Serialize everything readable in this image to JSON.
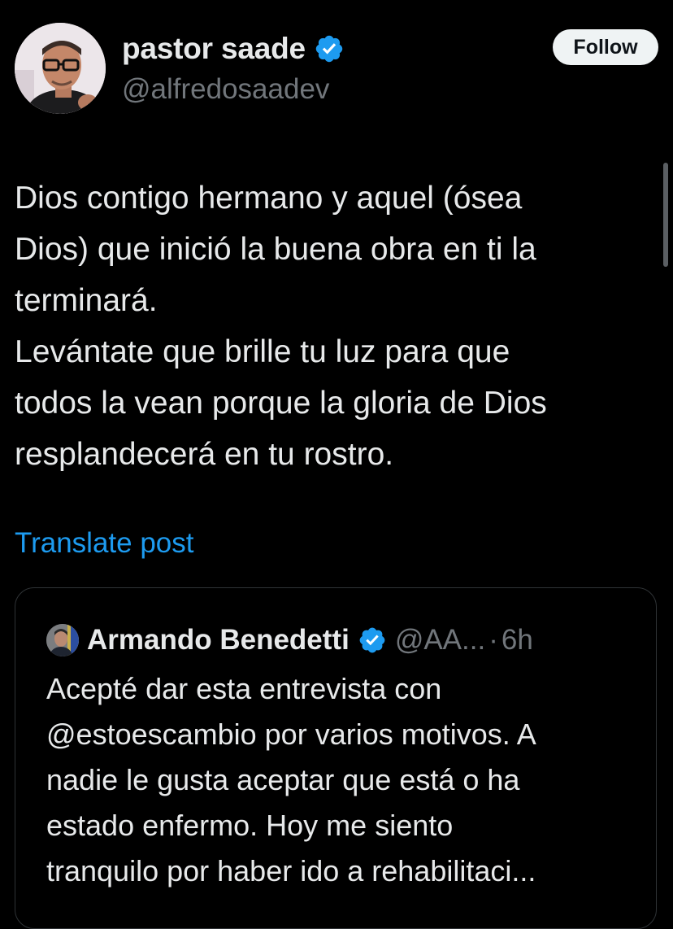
{
  "post": {
    "author": {
      "display_name": "pastor saade",
      "handle": "@alfredosaadev",
      "verified_icon": "verified-badge-icon",
      "avatar": "avatar-photo"
    },
    "follow_label": "Follow",
    "text": "Dios contigo hermano y aquel (ósea\nDios) que inició la buena obra en ti la\nterminará.\nLevántate que brille tu luz para que\ntodos la vean porque la gloria de Dios\nresplandecerá en tu rostro.",
    "translate_label": "Translate post"
  },
  "quote": {
    "author": {
      "display_name": "Armando Benedetti",
      "handle": "@AA...",
      "verified_icon": "verified-badge-icon",
      "avatar": "avatar-photo"
    },
    "separator": "·",
    "time": "6h",
    "text": "Acepté dar esta entrevista con\n@estoescambio por varios motivos. A\nnadie le gusta aceptar que está o ha\nestado enfermo. Hoy me siento\ntranquilo por haber ido a rehabilitaci..."
  },
  "colors": {
    "background": "#000000",
    "text_primary": "#e7e9ea",
    "text_secondary": "#71767b",
    "accent": "#1d9bf0",
    "follow_button_bg": "#eff3f4",
    "border": "#2f3336"
  }
}
